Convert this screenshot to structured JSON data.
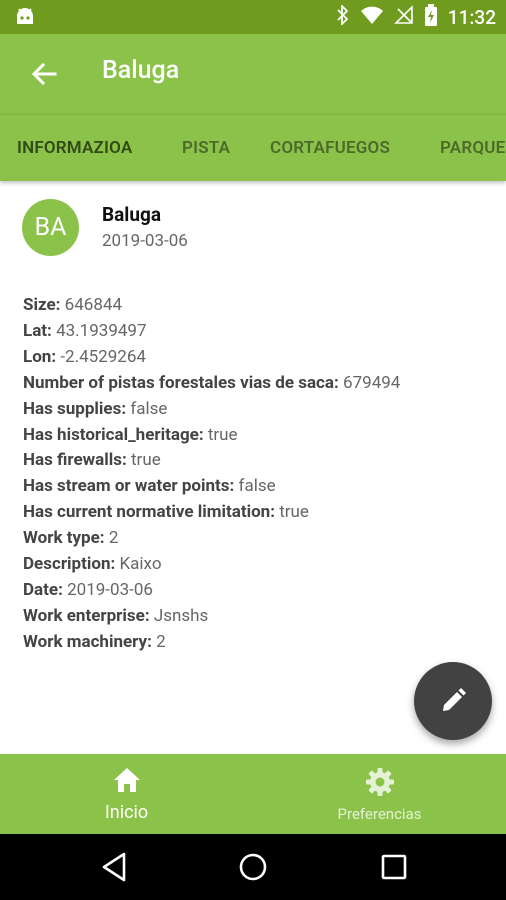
{
  "status_bar": {
    "time": "11:32",
    "icons": [
      "android-icon",
      "bluetooth-icon",
      "wifi-icon",
      "no-signal-icon",
      "battery-icon"
    ]
  },
  "app_bar": {
    "title": "Baluga",
    "back_icon": "arrow-back-icon"
  },
  "tabs": [
    {
      "label": "INFORMAZIOA",
      "active": true
    },
    {
      "label": "PISTA",
      "active": false
    },
    {
      "label": "CORTAFUEGOS",
      "active": false
    },
    {
      "label": "PARQUE",
      "active": false
    }
  ],
  "card": {
    "avatar_initials": "BA",
    "title": "Baluga",
    "date": "2019-03-06"
  },
  "details": [
    {
      "key": "Size:",
      "value": "646844"
    },
    {
      "key": "Lat:",
      "value": "43.1939497"
    },
    {
      "key": "Lon:",
      "value": "-2.4529264"
    },
    {
      "key": "Number of pistas forestales vias de saca:",
      "value": "679494"
    },
    {
      "key": "Has supplies:",
      "value": "false"
    },
    {
      "key": "Has historical_heritage:",
      "value": "true"
    },
    {
      "key": "Has firewalls:",
      "value": "true"
    },
    {
      "key": "Has stream or water points:",
      "value": "false"
    },
    {
      "key": "Has current normative limitation:",
      "value": "true"
    },
    {
      "key": "Work type:",
      "value": "2"
    },
    {
      "key": "Description:",
      "value": "Kaixo"
    },
    {
      "key": "Date:",
      "value": "2019-03-06"
    },
    {
      "key": "Work enterprise:",
      "value": "Jsnshs"
    },
    {
      "key": "Work machinery:",
      "value": "2"
    }
  ],
  "fab": {
    "icon": "edit-pencil-icon"
  },
  "bottom_nav": {
    "items": [
      {
        "label": "Inicio",
        "icon": "home-icon",
        "active": true
      },
      {
        "label": "Preferencias",
        "icon": "gear-icon",
        "active": false
      }
    ]
  },
  "system_nav": {
    "icons": [
      "back-triangle-icon",
      "home-circle-icon",
      "recents-square-icon"
    ]
  },
  "colors": {
    "status_bar": "#6f9b1f",
    "primary": "#8bc34a",
    "fab": "#424242",
    "tab_text": "#4e6a2b"
  }
}
